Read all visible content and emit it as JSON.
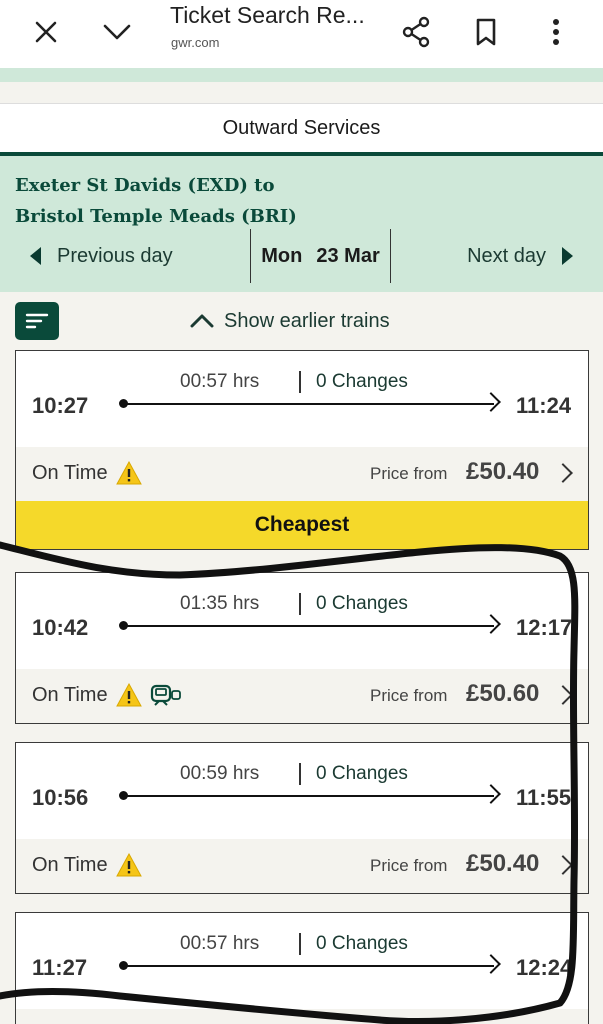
{
  "browser": {
    "title": "Ticket Search Re...",
    "domain": "gwr.com",
    "icons": [
      "close-icon",
      "chevron-down-icon",
      "share-icon",
      "bookmark-icon",
      "more-vert-icon"
    ]
  },
  "header": {
    "outward_label": "Outward Services",
    "route_line1": "Exeter St Davids (EXD) to",
    "route_line2": "Bristol Temple Meads (BRI)",
    "prev_day": "Previous day",
    "day_name": "Mon",
    "day_date": "23 Mar",
    "next_day": "Next day"
  },
  "controls": {
    "show_earlier": "Show earlier trains"
  },
  "trains": [
    {
      "duration": "00:57 hrs",
      "changes": "0 Changes",
      "depart": "10:27",
      "arrive": "11:24",
      "status": "On Time",
      "price_label": "Price from",
      "price": "£50.40",
      "badge": "Cheapest"
    },
    {
      "duration": "01:35 hrs",
      "changes": "0 Changes",
      "depart": "10:42",
      "arrive": "12:17",
      "status": "On Time",
      "price_label": "Price from",
      "price": "£50.60"
    },
    {
      "duration": "00:59 hrs",
      "changes": "0 Changes",
      "depart": "10:56",
      "arrive": "11:55",
      "status": "On Time",
      "price_label": "Price from",
      "price": "£50.40"
    },
    {
      "duration": "00:57 hrs",
      "changes": "0 Changes",
      "depart": "11:27",
      "arrive": "12:24"
    }
  ],
  "colors": {
    "brand_green": "#0a4a3a",
    "route_bg": "#cfe8d9",
    "cheapest_yellow": "#f5d92a",
    "warning_yellow": "#f5c518"
  }
}
